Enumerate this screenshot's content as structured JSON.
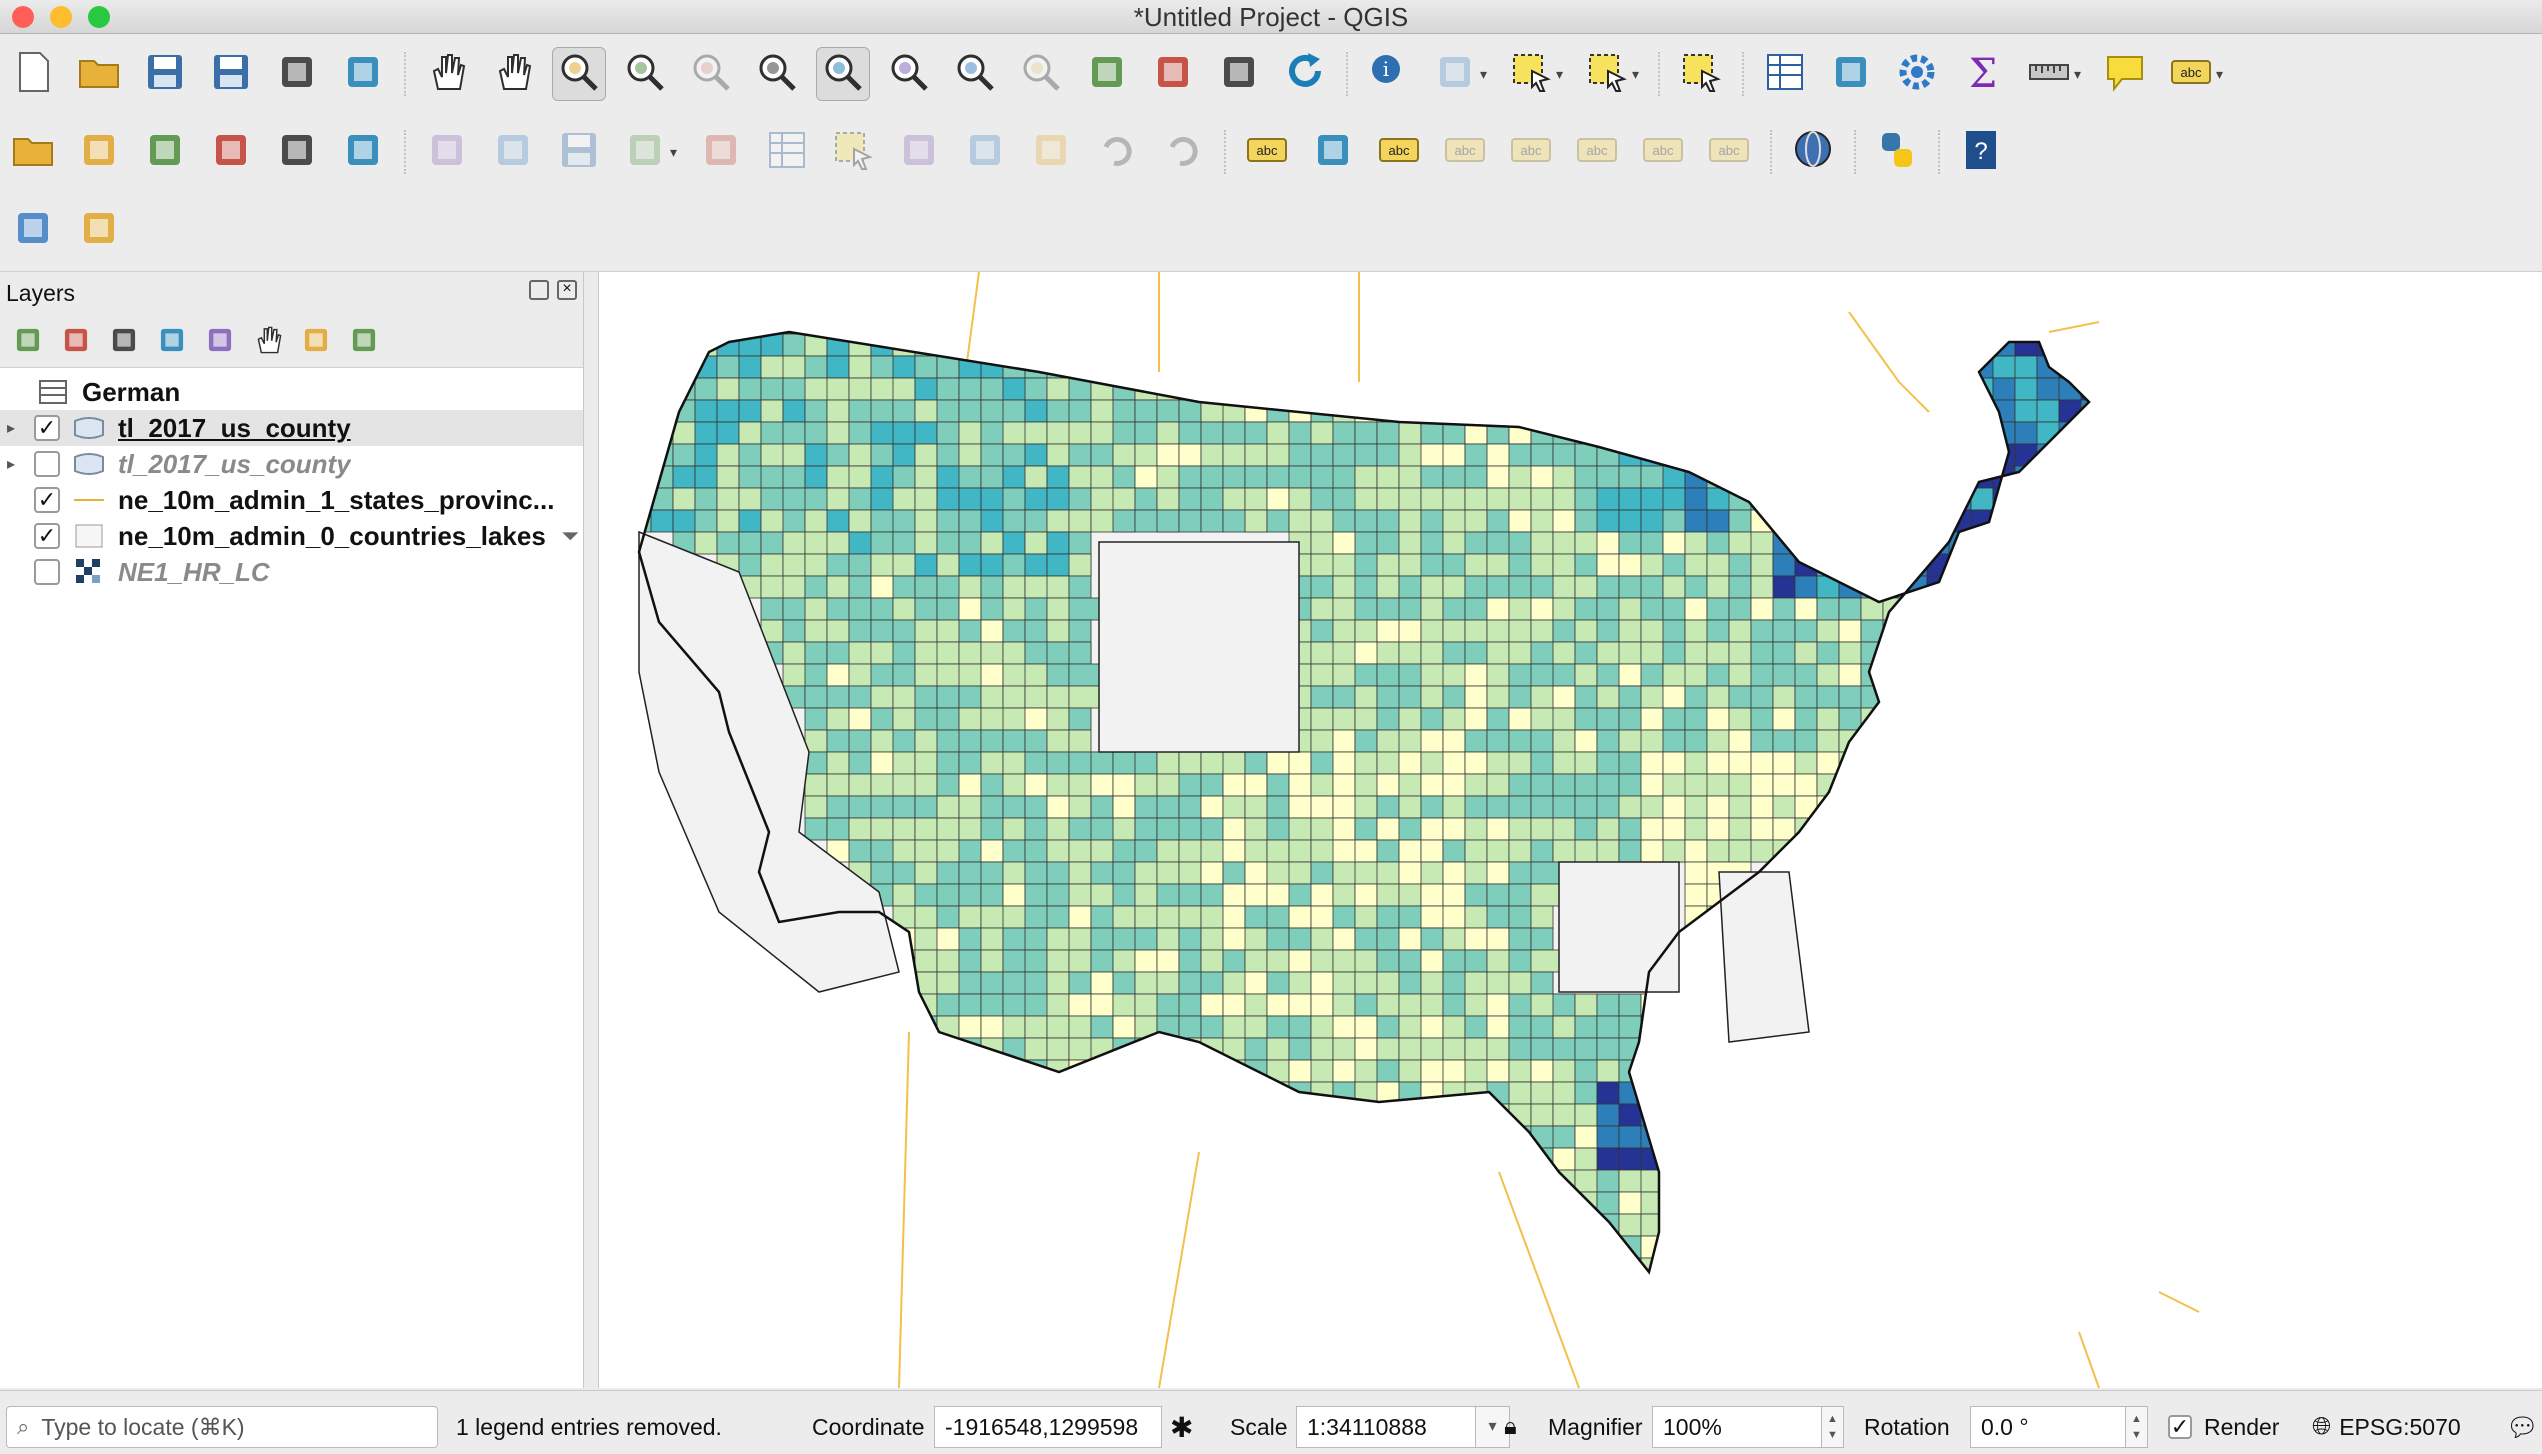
{
  "window": {
    "title": "*Untitled Project - QGIS",
    "traffic_lights": [
      "#ff5f57",
      "#febc2e",
      "#28c840"
    ]
  },
  "toolbar_row1": [
    "new-project-icon",
    "open-project-icon",
    "save-project-icon",
    "save-as-icon",
    "print-layout-icon",
    "style-manager-icon",
    "pan-icon",
    "pan-to-selection-icon",
    "zoom-in-icon",
    "zoom-out-icon",
    "zoom-native-icon",
    "zoom-full-icon",
    "zoom-to-selection-icon",
    "zoom-to-layer-icon",
    "zoom-last-icon",
    "zoom-next-icon",
    "new-bookmark-icon",
    "show-bookmarks-icon",
    "spatial-bookmark-icon",
    "refresh-icon",
    "identify-icon",
    "run-action-icon",
    "select-features-icon",
    "select-by-value-icon",
    "deselect-icon",
    "attribute-table-icon",
    "field-calculator-icon",
    "toolbox-icon",
    "statistics-icon",
    "measure-icon",
    "map-tips-icon",
    "text-annotation-icon"
  ],
  "toolbar_row2": [
    "data-source-manager-icon",
    "new-geopackage-icon",
    "new-shapefile-icon",
    "digitize-icon",
    "new-temp-layer-icon",
    "new-virtual-layer-icon",
    "toggle-editing-icon",
    "current-edits-icon",
    "save-edits-icon",
    "add-feature-icon",
    "vertex-tool-icon",
    "modify-attributes-icon",
    "delete-selected-icon",
    "cut-features-icon",
    "copy-features-icon",
    "paste-features-icon",
    "undo-icon",
    "redo-icon",
    "label-tool-icon",
    "diagram-tool-icon",
    "pin-labels-icon",
    "highlight-labels-icon",
    "show-hide-labels-icon",
    "move-label-icon",
    "rotate-label-icon",
    "change-label-icon",
    "globe-icon",
    "python-icon",
    "help-icon"
  ],
  "toolbar_row3": [
    "locator-icon",
    "plugin-icon"
  ],
  "layers_panel": {
    "title": "Layers",
    "tools": [
      "style-icon",
      "add-group-icon",
      "visibility-icon",
      "filter-legend-icon",
      "expression-filter-icon",
      "expand-all-icon",
      "collapse-all-icon",
      "remove-layer-icon"
    ],
    "items": [
      {
        "name": "German",
        "type": "table",
        "checked": null,
        "expandable": false,
        "italic": false,
        "selected": false
      },
      {
        "name": "tl_2017_us_county",
        "type": "polygon",
        "checked": true,
        "expandable": true,
        "italic": false,
        "selected": true
      },
      {
        "name": "tl_2017_us_county",
        "type": "polygon",
        "checked": false,
        "expandable": true,
        "italic": true,
        "selected": false
      },
      {
        "name": "ne_10m_admin_1_states_provinc...",
        "type": "line",
        "checked": true,
        "expandable": false,
        "italic": false,
        "selected": false
      },
      {
        "name": "ne_10m_admin_0_countries_lakes",
        "type": "fill",
        "checked": true,
        "expandable": false,
        "italic": false,
        "selected": false
      },
      {
        "name": "NE1_HR_LC",
        "type": "raster",
        "checked": false,
        "expandable": false,
        "italic": true,
        "selected": false
      }
    ]
  },
  "statusbar": {
    "locate_placeholder": "Type to locate (⌘K)",
    "message": "1 legend entries removed.",
    "coordinate_label": "Coordinate",
    "coordinate_value": "-1916548,1299598",
    "scale_label": "Scale",
    "scale_value": "1:34110888",
    "magnifier_label": "Magnifier",
    "magnifier_value": "100%",
    "rotation_label": "Rotation",
    "rotation_value": "0.0 °",
    "render_label": "Render",
    "render_checked": true,
    "crs": "EPSG:5070"
  },
  "map": {
    "palette": [
      "#ffffcc",
      "#c7e9b4",
      "#7fcdbb",
      "#41b6c4",
      "#2c7fb8",
      "#253494"
    ],
    "nodata_fill": "#f2f2f2",
    "border_color": "#f3c14b"
  }
}
